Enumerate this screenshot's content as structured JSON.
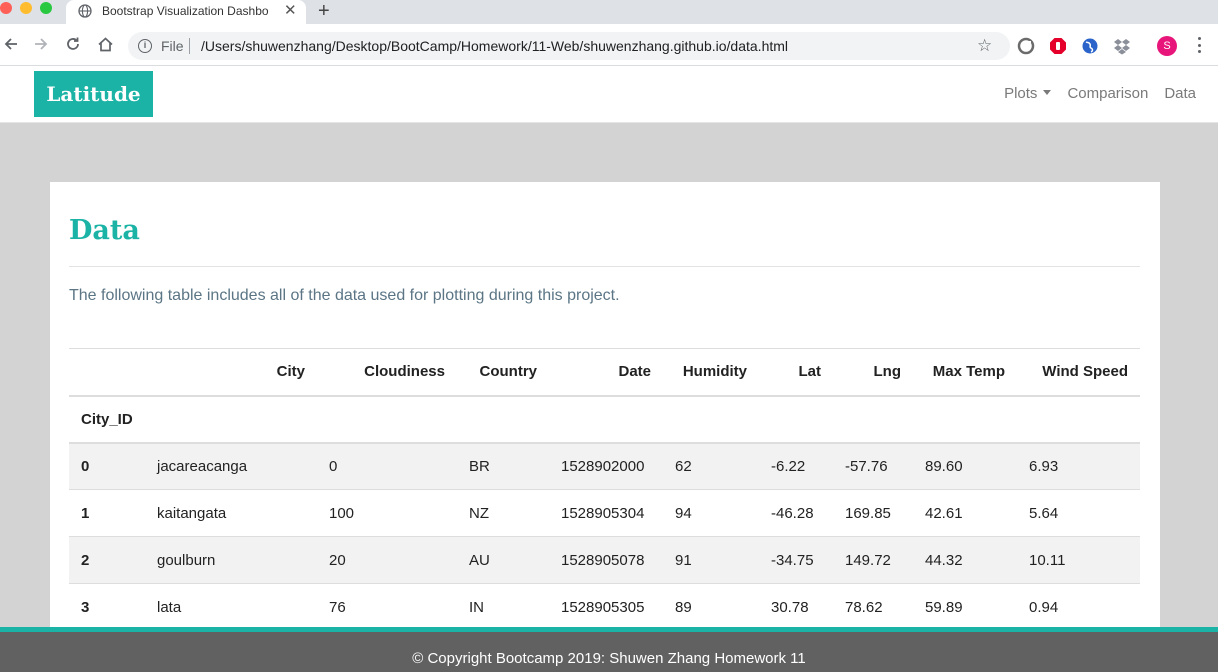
{
  "browser": {
    "tab_title": "Bootstrap Visualization Dashbo",
    "file_label": "File",
    "url": "/Users/shuwenzhang/Desktop/BootCamp/Homework/11-Web/shuwenzhang.github.io/data.html",
    "profile_initial": "S",
    "profile_color": "#e8157a"
  },
  "navbar": {
    "brand": "Latitude",
    "links": [
      "Plots",
      "Comparison",
      "Data"
    ],
    "accent_color": "#1ab3a6"
  },
  "page": {
    "title": "Data",
    "intro": "The following table includes all of the data used for plotting during this project."
  },
  "table": {
    "columns": [
      "City",
      "Cloudiness",
      "Country",
      "Date",
      "Humidity",
      "Lat",
      "Lng",
      "Max Temp",
      "Wind Speed"
    ],
    "index_label": "City_ID",
    "rows": [
      {
        "id": "0",
        "cells": [
          "jacareacanga",
          "0",
          "BR",
          "1528902000",
          "62",
          "-6.22",
          "-57.76",
          "89.60",
          "6.93"
        ]
      },
      {
        "id": "1",
        "cells": [
          "kaitangata",
          "100",
          "NZ",
          "1528905304",
          "94",
          "-46.28",
          "169.85",
          "42.61",
          "5.64"
        ]
      },
      {
        "id": "2",
        "cells": [
          "goulburn",
          "20",
          "AU",
          "1528905078",
          "91",
          "-34.75",
          "149.72",
          "44.32",
          "10.11"
        ]
      },
      {
        "id": "3",
        "cells": [
          "lata",
          "76",
          "IN",
          "1528905305",
          "89",
          "30.78",
          "78.62",
          "59.89",
          "0.94"
        ]
      }
    ]
  },
  "footer": {
    "text": "© Copyright Bootcamp 2019: Shuwen Zhang Homework 11"
  }
}
